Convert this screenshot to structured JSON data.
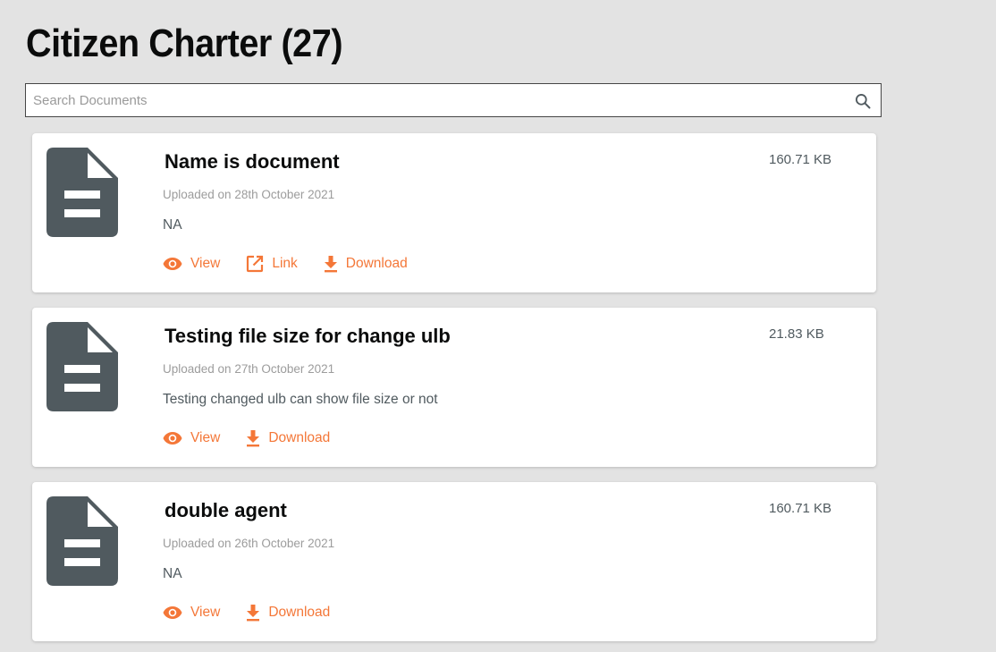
{
  "page": {
    "title": "Citizen Charter (27)"
  },
  "search": {
    "placeholder": "Search Documents",
    "value": ""
  },
  "colors": {
    "accent": "#f47738",
    "icon_gray": "#505a5f",
    "background": "#e3e3e3"
  },
  "documents": [
    {
      "title": "Name is document",
      "size": "160.71 KB",
      "uploaded": "Uploaded on 28th October 2021",
      "description": "NA",
      "actions": {
        "view": "View",
        "link": "Link",
        "download": "Download"
      }
    },
    {
      "title": "Testing file size for change ulb",
      "size": "21.83 KB",
      "uploaded": "Uploaded on 27th October 2021",
      "description": "Testing changed ulb can show file size or not",
      "actions": {
        "view": "View",
        "download": "Download"
      }
    },
    {
      "title": "double agent",
      "size": "160.71 KB",
      "uploaded": "Uploaded on 26th October 2021",
      "description": "NA",
      "actions": {
        "view": "View",
        "download": "Download"
      }
    }
  ]
}
